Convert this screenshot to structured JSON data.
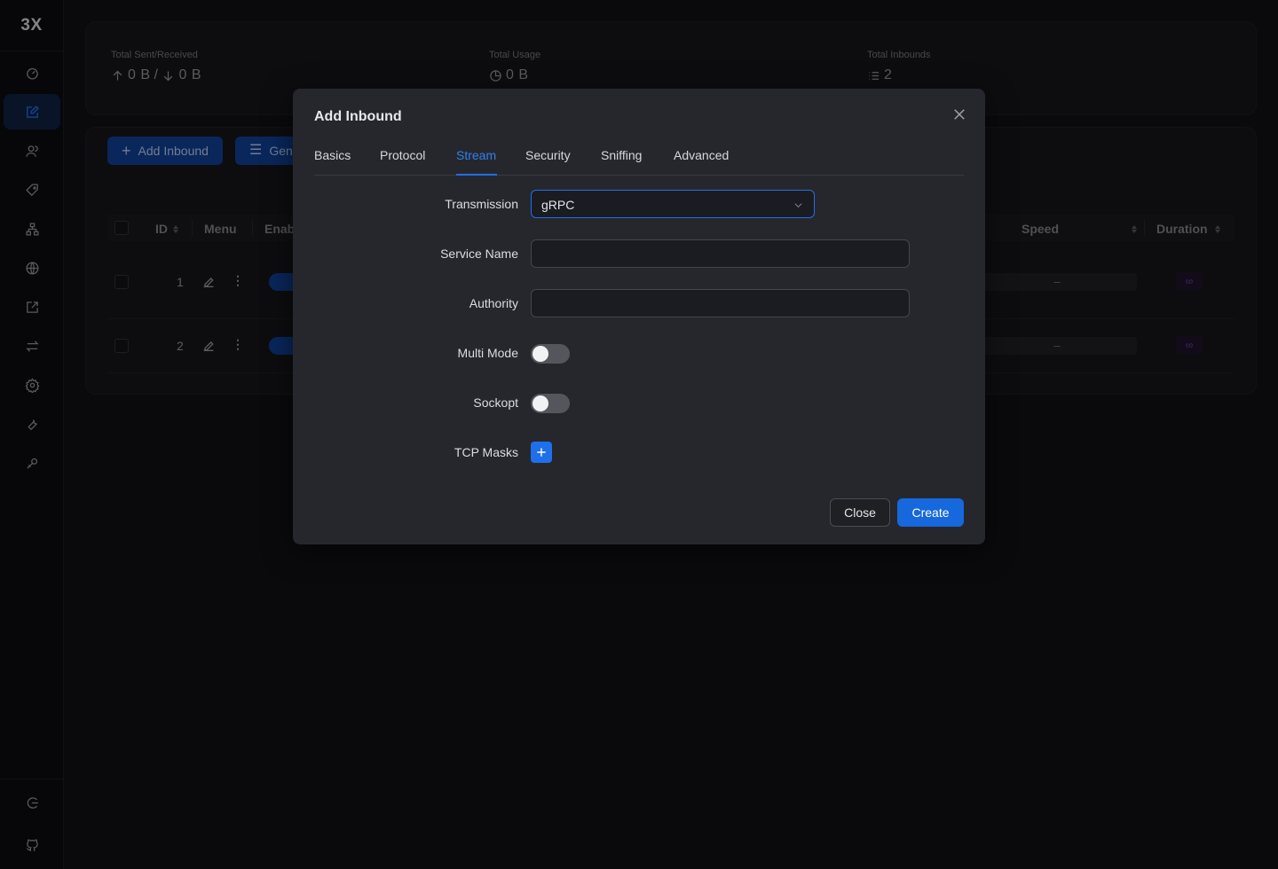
{
  "app": {
    "logo": "3X"
  },
  "stats": {
    "sent_received": {
      "label": "Total Sent/Received",
      "up": "0 B",
      "separator": "/",
      "down": "0 B"
    },
    "usage": {
      "label": "Total Usage",
      "value": "0 B"
    },
    "inbounds": {
      "label": "Total Inbounds",
      "value": "2"
    }
  },
  "toolbar": {
    "add_inbound": "Add Inbound",
    "general": "Gen"
  },
  "table": {
    "headers": {
      "id": "ID",
      "menu": "Menu",
      "enable": "Enab",
      "speed": "Speed",
      "duration": "Duration"
    },
    "rows": [
      {
        "id": "1",
        "speed": "–",
        "duration": "∞"
      },
      {
        "id": "2",
        "speed": "–",
        "duration": "∞"
      }
    ]
  },
  "modal": {
    "title": "Add Inbound",
    "tabs": [
      "Basics",
      "Protocol",
      "Stream",
      "Security",
      "Sniffing",
      "Advanced"
    ],
    "active_tab": "Stream",
    "fields": {
      "transmission": {
        "label": "Transmission",
        "value": "gRPC"
      },
      "service_name": {
        "label": "Service Name",
        "value": ""
      },
      "authority": {
        "label": "Authority",
        "value": ""
      },
      "multi_mode": {
        "label": "Multi Mode",
        "on": false
      },
      "sockopt": {
        "label": "Sockopt",
        "on": false
      },
      "tcp_masks": {
        "label": "TCP Masks"
      }
    },
    "buttons": {
      "close": "Close",
      "create": "Create"
    }
  },
  "colors": {
    "accent": "#1f6feb",
    "modal_bg": "#26272d",
    "page_bg": "#101013"
  }
}
